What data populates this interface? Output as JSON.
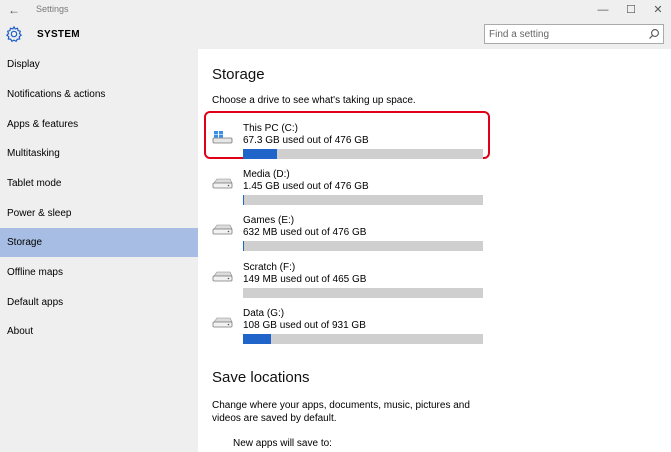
{
  "window": {
    "back_glyph": "←",
    "title": "Settings",
    "controls": {
      "minimize": "—",
      "maximize": "☐",
      "close": "✕"
    }
  },
  "header": {
    "icon": "gear-icon",
    "title": "SYSTEM",
    "search_placeholder": "Find a setting"
  },
  "sidebar": {
    "items": [
      {
        "label": "Display",
        "selected": false
      },
      {
        "label": "Notifications & actions",
        "selected": false
      },
      {
        "label": "Apps & features",
        "selected": false
      },
      {
        "label": "Multitasking",
        "selected": false
      },
      {
        "label": "Tablet mode",
        "selected": false
      },
      {
        "label": "Power & sleep",
        "selected": false
      },
      {
        "label": "Storage",
        "selected": true
      },
      {
        "label": "Offline maps",
        "selected": false
      },
      {
        "label": "Default apps",
        "selected": false
      },
      {
        "label": "About",
        "selected": false
      }
    ],
    "selected_color": "#a7bde3"
  },
  "main": {
    "heading": "Storage",
    "description": "Choose a drive to see what's taking up space.",
    "drives": [
      {
        "name": "This PC (C:)",
        "usage": "67.3 GB used out of 476 GB",
        "used_fraction": 0.141,
        "icon": "windows-drive-icon",
        "highlighted": true
      },
      {
        "name": "Media (D:)",
        "usage": "1.45 GB used out of 476 GB",
        "used_fraction": 0.003,
        "icon": "hard-drive-icon",
        "highlighted": false
      },
      {
        "name": "Games (E:)",
        "usage": "632 MB used out of 476 GB",
        "used_fraction": 0.0013,
        "icon": "hard-drive-icon",
        "highlighted": false
      },
      {
        "name": "Scratch (F:)",
        "usage": "149 MB used out of 465 GB",
        "used_fraction": 0.0003,
        "icon": "hard-drive-icon",
        "highlighted": false
      },
      {
        "name": "Data (G:)",
        "usage": "108 GB used out of 931 GB",
        "used_fraction": 0.116,
        "icon": "hard-drive-icon",
        "highlighted": false
      }
    ],
    "bar_color": "#1f64c8",
    "bar_track_color": "#cfcfcf",
    "highlight_color": "#e0001a",
    "save_heading": "Save locations",
    "save_description": "Change where your apps, documents, music, pictures and videos are saved by default.",
    "new_apps_label": "New apps will save to:"
  }
}
